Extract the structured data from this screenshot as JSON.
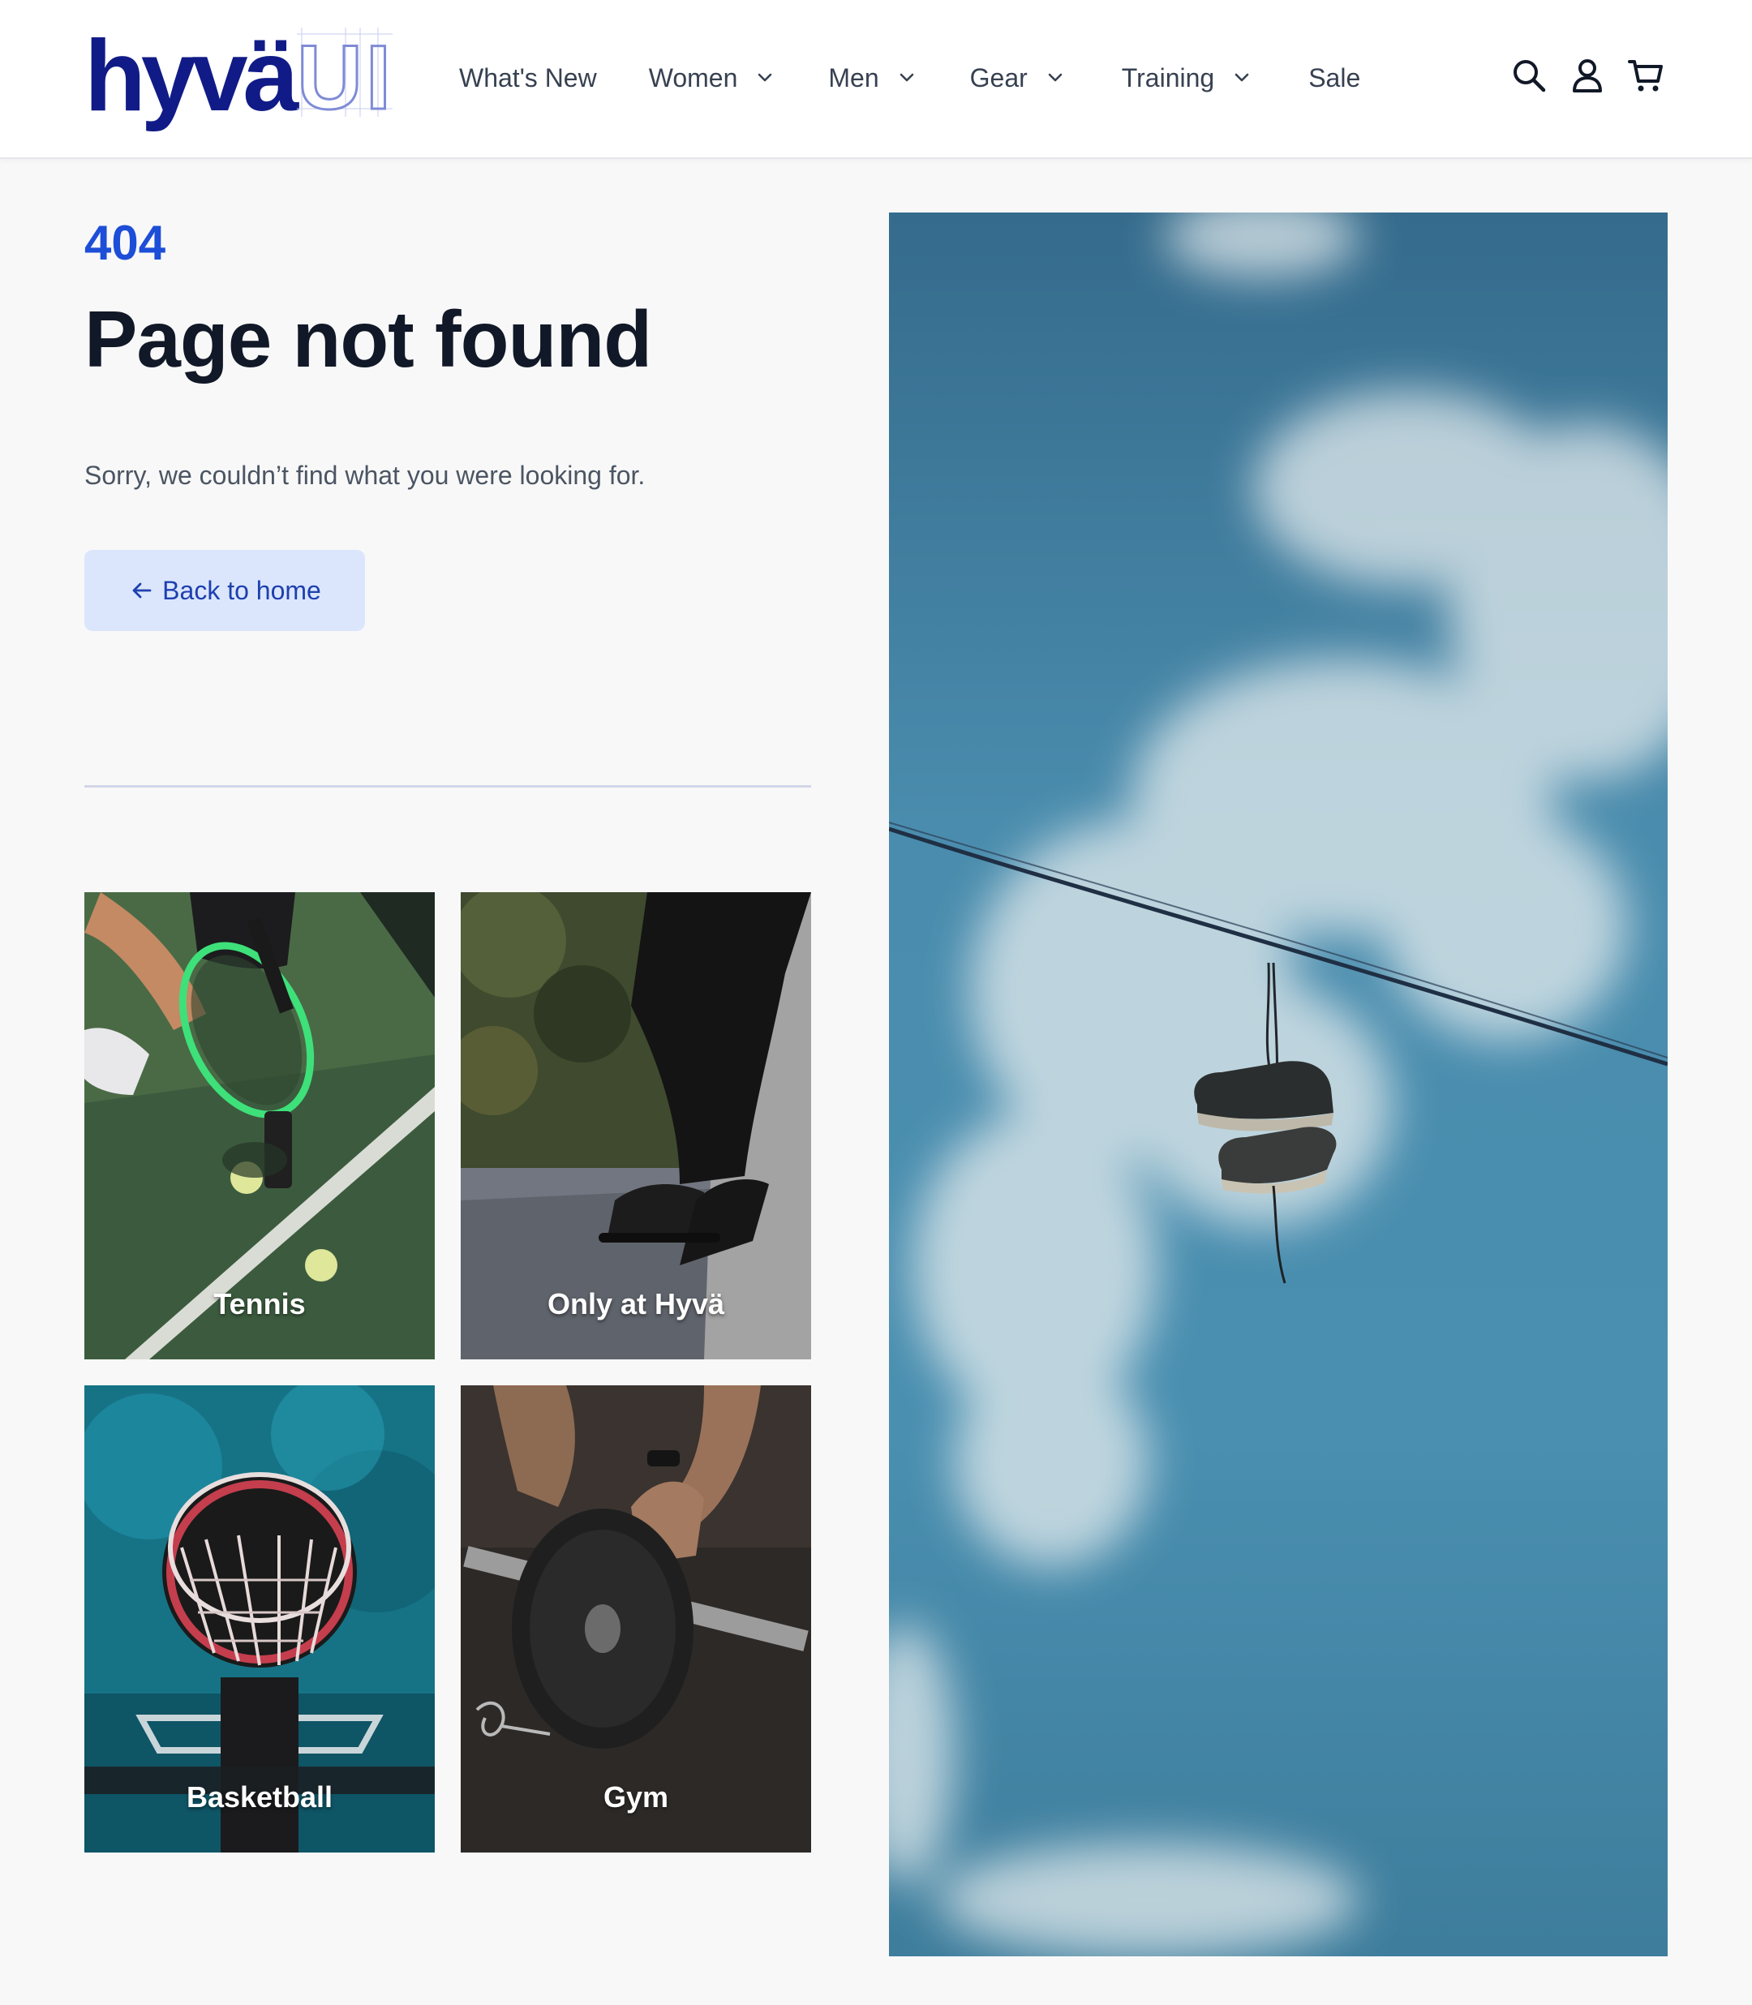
{
  "logo": {
    "word": "hyvä",
    "suffix": "UI"
  },
  "nav": {
    "items": [
      {
        "label": "What's New",
        "has_dropdown": false
      },
      {
        "label": "Women",
        "has_dropdown": true
      },
      {
        "label": "Men",
        "has_dropdown": true
      },
      {
        "label": "Gear",
        "has_dropdown": true
      },
      {
        "label": "Training",
        "has_dropdown": true
      },
      {
        "label": "Sale",
        "has_dropdown": false
      }
    ]
  },
  "header_icons": [
    "search-icon",
    "account-icon",
    "cart-icon"
  ],
  "error": {
    "code": "404",
    "title": "Page not found",
    "message": "Sorry, we couldn’t find what you were looking for.",
    "back_label": "Back to home"
  },
  "categories": [
    {
      "label": "Tennis"
    },
    {
      "label": "Only at Hyvä"
    },
    {
      "label": "Basketball"
    },
    {
      "label": "Gym"
    }
  ],
  "colors": {
    "brand": "#111b87",
    "accent": "#1d4ed8",
    "button_bg": "#dbe6fd",
    "page_bg": "#f8f8f8"
  }
}
